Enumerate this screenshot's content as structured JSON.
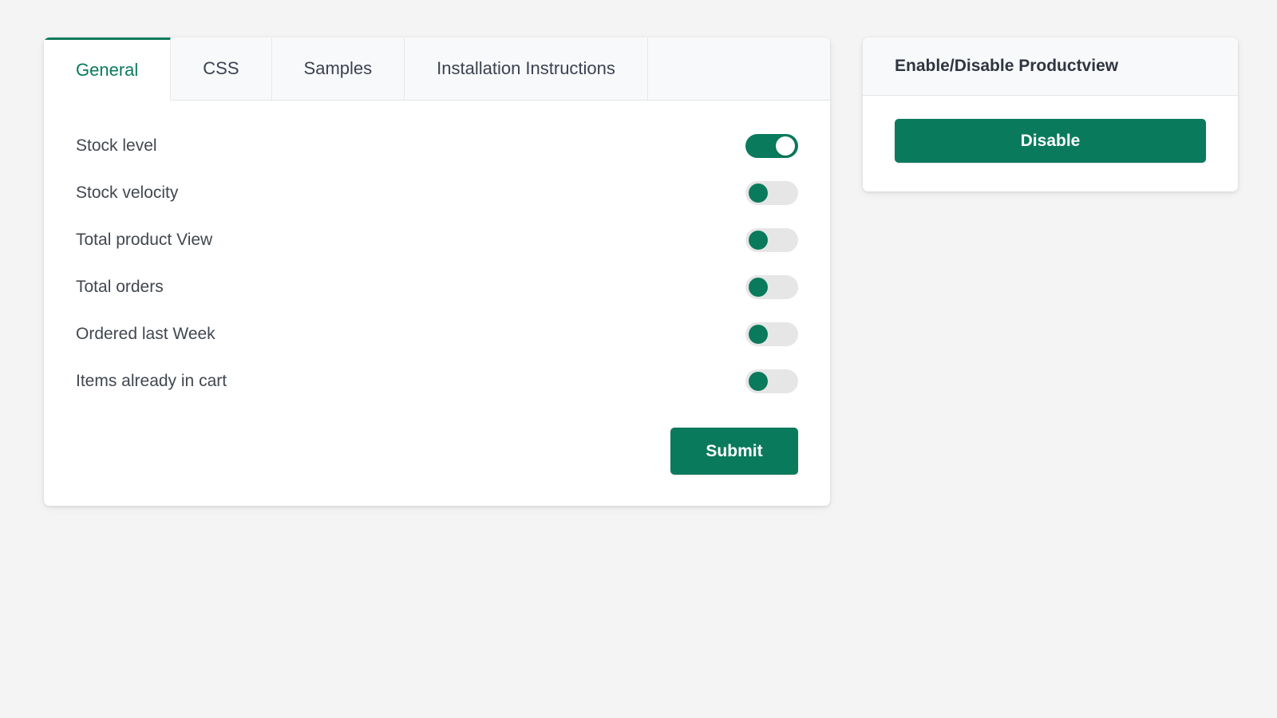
{
  "theme": {
    "accent": "#0a7a5c",
    "page_background": "#f4f4f4",
    "card_background": "#ffffff",
    "tab_inactive_background": "#f8f9fa",
    "toggle_off_track": "#e6e6e6",
    "label_color": "#41474f"
  },
  "settings_panel": {
    "tabs": [
      {
        "label": "General",
        "active": true
      },
      {
        "label": "CSS",
        "active": false
      },
      {
        "label": "Samples",
        "active": false
      },
      {
        "label": "Installation Instructions",
        "active": false
      }
    ],
    "options": [
      {
        "label": "Stock level",
        "enabled": true
      },
      {
        "label": "Stock velocity",
        "enabled": false
      },
      {
        "label": "Total product View",
        "enabled": false
      },
      {
        "label": "Total orders",
        "enabled": false
      },
      {
        "label": "Ordered last Week",
        "enabled": false
      },
      {
        "label": "Items already in cart",
        "enabled": false
      }
    ],
    "submit_label": "Submit"
  },
  "productview_panel": {
    "title": "Enable/Disable Productview",
    "action_label": "Disable"
  }
}
